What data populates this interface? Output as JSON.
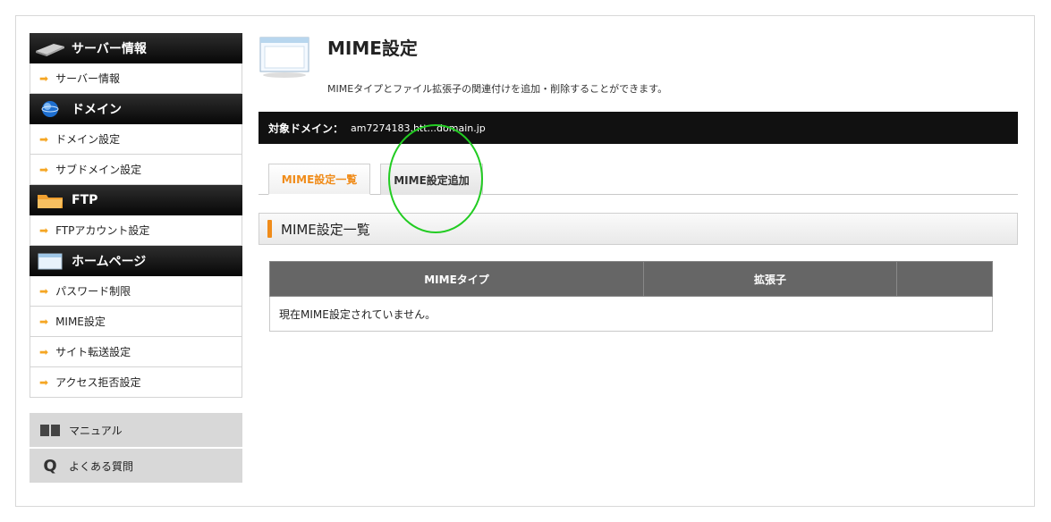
{
  "sidebar": {
    "sections": [
      {
        "title": "サーバー情報",
        "icon": "server-icon",
        "items": [
          "サーバー情報"
        ]
      },
      {
        "title": "ドメイン",
        "icon": "globe-icon",
        "items": [
          "ドメイン設定",
          "サブドメイン設定"
        ]
      },
      {
        "title": "FTP",
        "icon": "folder-icon",
        "items": [
          "FTPアカウント設定"
        ]
      },
      {
        "title": "ホームページ",
        "icon": "window-icon",
        "items": [
          "パスワード制限",
          "MIME設定",
          "サイト転送設定",
          "アクセス拒否設定"
        ]
      }
    ],
    "sub_links": [
      {
        "label": "マニュアル",
        "icon": "book-icon"
      },
      {
        "label": "よくある質問",
        "icon": "faq-q-icon"
      }
    ]
  },
  "main": {
    "title": "MIME設定",
    "description": "MIMEタイプとファイル拡張子の関連付けを追加・削除することができます。",
    "domain_label": "対象ドメイン：",
    "domain_value": "am7274183.htt...domain.jp",
    "tabs": [
      {
        "label": "MIME設定一覧",
        "active": true
      },
      {
        "label": "MIME設定追加",
        "active": false
      }
    ],
    "section_title": "MIME設定一覧",
    "table": {
      "headers": [
        "MIMEタイプ",
        "拡張子",
        ""
      ],
      "empty_message": "現在MIME設定されていません。"
    }
  },
  "colors": {
    "accent": "#f08c1a",
    "header_dark": "#111111",
    "table_header": "#666666",
    "highlight_circle": "#22cc22"
  }
}
